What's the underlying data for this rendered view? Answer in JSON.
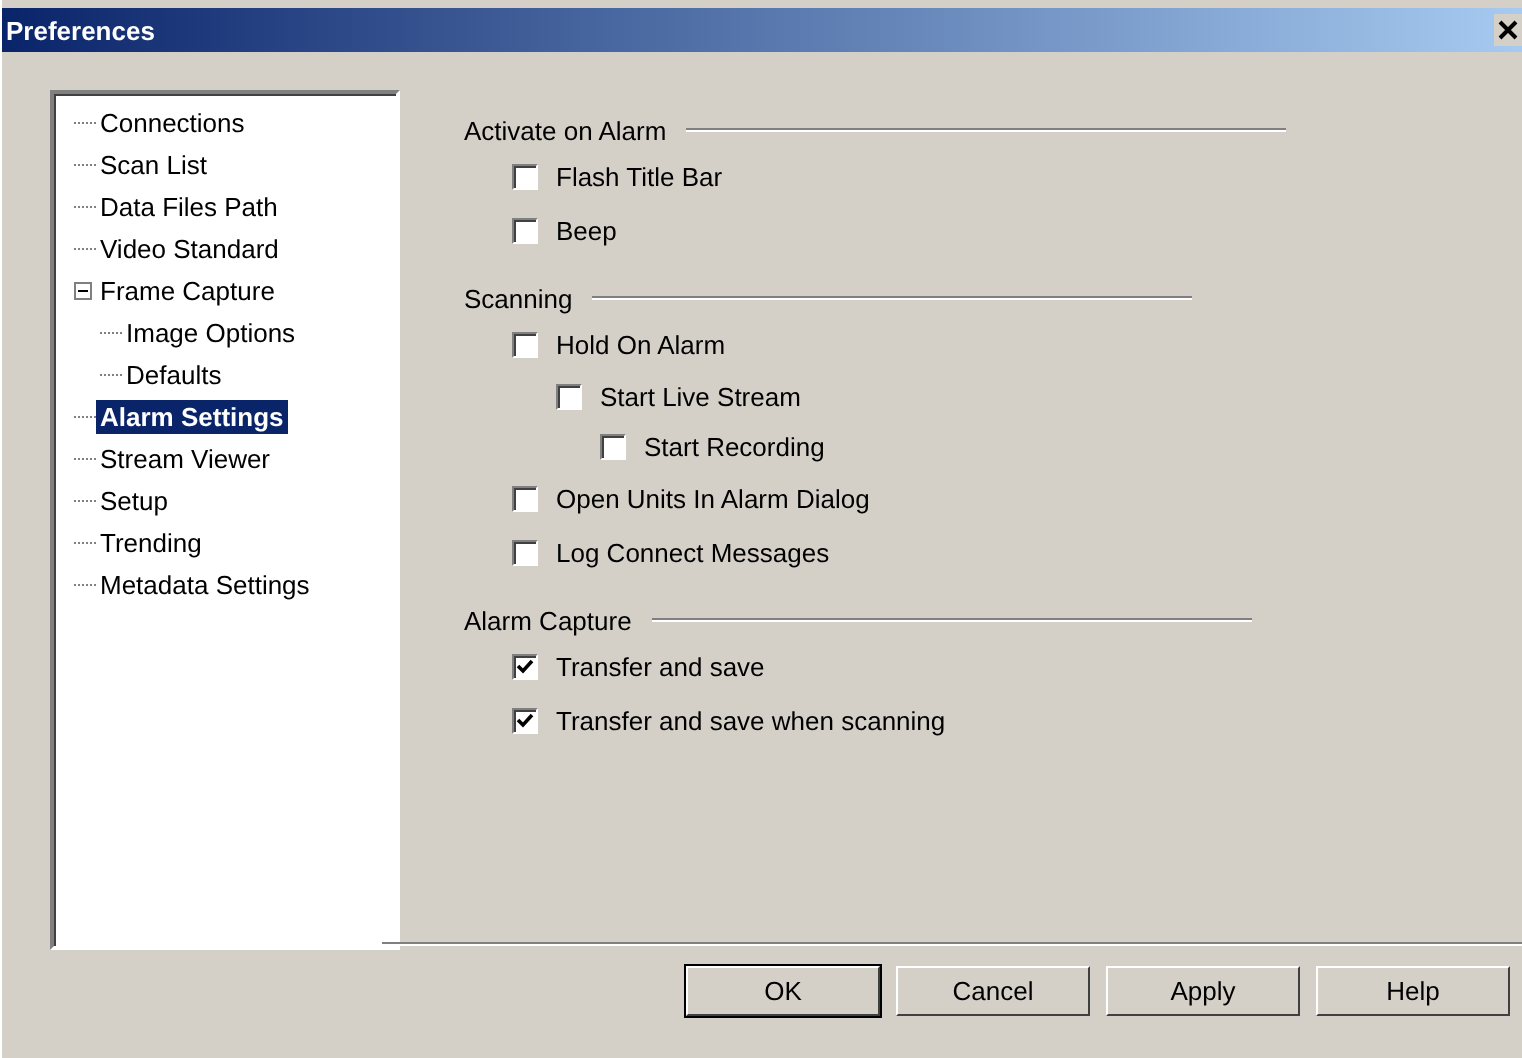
{
  "window": {
    "title": "Preferences"
  },
  "tree": [
    {
      "label": "Connections",
      "selected": false
    },
    {
      "label": "Scan List",
      "selected": false
    },
    {
      "label": "Data Files Path",
      "selected": false
    },
    {
      "label": "Video Standard",
      "selected": false
    },
    {
      "label": "Frame Capture",
      "selected": false,
      "expanded": true,
      "children": [
        {
          "label": "Image Options",
          "selected": false
        },
        {
          "label": "Defaults",
          "selected": false
        }
      ]
    },
    {
      "label": "Alarm Settings",
      "selected": true
    },
    {
      "label": "Stream Viewer",
      "selected": false
    },
    {
      "label": "Setup",
      "selected": false
    },
    {
      "label": "Trending",
      "selected": false
    },
    {
      "label": "Metadata Settings",
      "selected": false
    }
  ],
  "groups": [
    {
      "title": "Activate on Alarm",
      "options": [
        {
          "label": "Flash Title Bar",
          "checked": false
        },
        {
          "label": "Beep",
          "checked": false
        }
      ]
    },
    {
      "title": "Scanning",
      "options": [
        {
          "label": "Hold On Alarm",
          "checked": false,
          "children": [
            {
              "label": "Start Live Stream",
              "checked": false,
              "children": [
                {
                  "label": "Start Recording",
                  "checked": false
                }
              ]
            }
          ]
        },
        {
          "label": "Open Units In Alarm Dialog",
          "checked": false
        },
        {
          "label": "Log Connect Messages",
          "checked": false
        }
      ]
    },
    {
      "title": "Alarm Capture",
      "options": [
        {
          "label": "Transfer and save",
          "checked": true
        },
        {
          "label": "Transfer and save when scanning",
          "checked": true
        }
      ]
    }
  ],
  "buttons": [
    "OK",
    "Cancel",
    "Apply",
    "Help"
  ]
}
